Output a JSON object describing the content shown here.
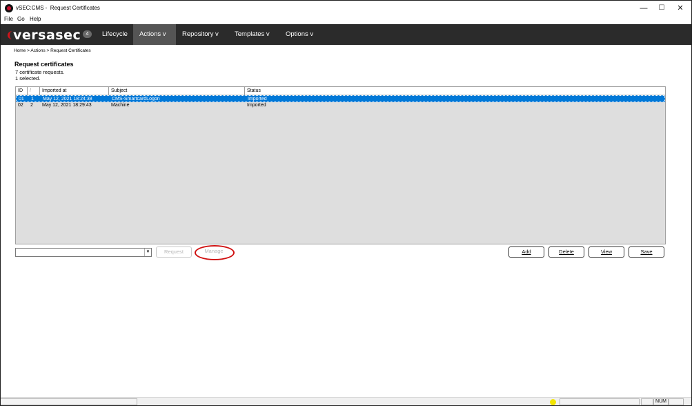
{
  "window": {
    "title": "vSEC:CMS -  Request Certificates"
  },
  "menubar": {
    "items": [
      "File",
      "Go",
      "Help"
    ]
  },
  "nav": {
    "logo": "versasec",
    "badge": "4",
    "items": [
      {
        "label": "Lifecycle"
      },
      {
        "label": "Actions  v"
      },
      {
        "label": "Repository  v"
      },
      {
        "label": "Templates  v"
      },
      {
        "label": "Options  v"
      }
    ],
    "active": "Actions"
  },
  "breadcrumb": "Home > Actions > Request Certificates",
  "page": {
    "title": "Request certificates",
    "count_text": "7 certificate requests.",
    "selected_text": "1 selected."
  },
  "table": {
    "headers": [
      "ID",
      "/",
      "Imported at",
      "Subject",
      "Status"
    ],
    "rows": [
      {
        "id": "01",
        "n": "1",
        "imported": "May 12, 2021 18:24:38",
        "subject": "CMS-SmartcardLogon",
        "status": "Imported",
        "selected": true
      },
      {
        "id": "02",
        "n": "2",
        "imported": "May 12, 2021 18:29:43",
        "subject": "Machine",
        "status": "Imported",
        "selected": false
      }
    ]
  },
  "controls": {
    "request_label": "Request",
    "manage_label": "Manage",
    "add_label": "Add",
    "delete_label": "Delete",
    "view_label": "View",
    "save_label": "Save"
  },
  "statusbar": {
    "num": "NUM"
  },
  "colors": {
    "accent": "#0078d7",
    "nav_bg": "#2b2b2b",
    "highlight_ring": "#d01010",
    "status_dot": "#f2e400"
  }
}
